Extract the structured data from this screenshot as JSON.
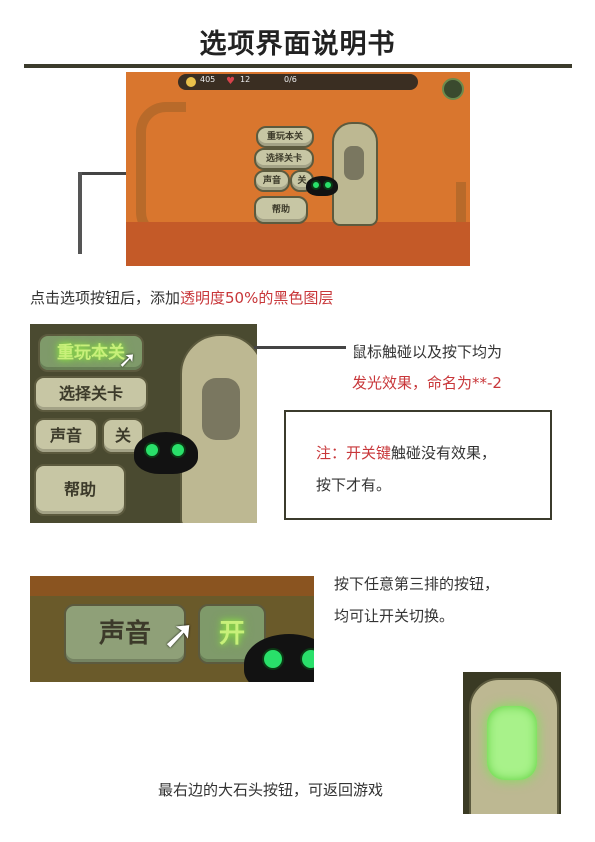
{
  "title": "选项界面说明书",
  "hud": {
    "coins": "405",
    "hearts": "12",
    "progress": "0/6"
  },
  "buttons": {
    "replay": "重玩本关",
    "select": "选择关卡",
    "sound": "声音",
    "off": "关",
    "help": "帮助",
    "on": "开"
  },
  "sections": {
    "desc1_a": "点击选项按钮后，添加",
    "desc1_b": "透明度50%的黑色图层",
    "desc2_line1": "鼠标触碰以及按下均为",
    "desc2_line2": "发光效果，命名为**-2",
    "note_a": "注：",
    "note_b": "开关键",
    "note_c": "触碰没有效果，",
    "note_line2": "按下才有。",
    "desc3_line1": "按下任意第三排的按钮，",
    "desc3_line2": "均可让开关切换。",
    "desc4": "最右边的大石头按钮，可返回游戏"
  },
  "colors": {
    "accent_red": "#c8373a",
    "rule": "#3b3b2c",
    "glow_green": "#9be34a"
  }
}
